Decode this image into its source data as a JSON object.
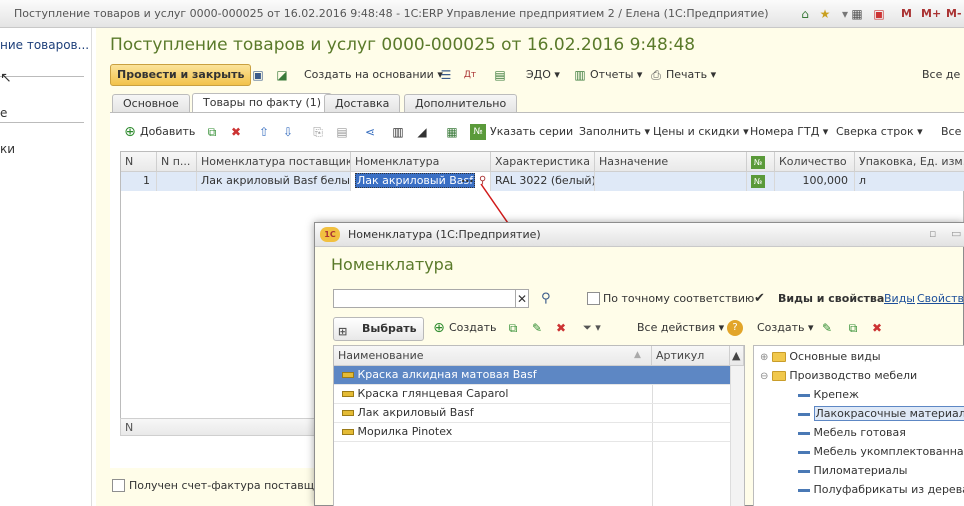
{
  "window": {
    "title": "Поступление товаров и услуг 0000-000025 от 16.02.2016 9:48:48 - 1С:ERP Управление предприятием 2 / Елена  (1С:Предприятие)",
    "m": "M",
    "mplus": "M+",
    "mminus": "M-"
  },
  "left": {
    "item1": "ние товаров...",
    "item2": "е",
    "item3": "ки"
  },
  "form": {
    "title": "Поступление товаров и услуг 0000-000025 от 16.02.2016 9:48:48",
    "post_close": "Провести и закрыть",
    "create_based": "Создать на основании",
    "edo": "ЭДО",
    "reports": "Отчеты",
    "print": "Печать",
    "all_actions": "Все де",
    "tabs": [
      "Основное",
      "Товары по факту (1)",
      "Доставка",
      "Дополнительно"
    ],
    "toolbar": {
      "add": "Добавить",
      "series": "Указать серии",
      "fill": "Заполнить",
      "prices": "Цены и скидки",
      "gtd": "Номера ГТД",
      "check": "Сверка строк",
      "all": "Все"
    },
    "columns": [
      "N",
      "N п...",
      "Номенклатура поставщика",
      "Номенклатура",
      "Характеристика",
      "Назначение",
      "№",
      "Количество",
      "Упаковка, Ед. изм."
    ],
    "row": {
      "n": "1",
      "supplier_item": "Лак акриловый Basf белый",
      "item": "Лак акриловый Basf",
      "dots": "...",
      "characteristic": "RAL 3022 (белый)",
      "quantity": "100,000",
      "unit": "л",
      "icon_label": "№"
    },
    "footer_col": "N",
    "invoice_check": "Получен счет-фактура поставщика N"
  },
  "dialog": {
    "title": "Номенклатура  (1С:Предприятие)",
    "heading": "Номенклатура",
    "exact": "По точному соответствию",
    "kinds": "Виды и свойства",
    "kinds_link": "Виды",
    "props_link": "Свойства",
    "select": "Выбрать",
    "create": "Создать",
    "all_actions": "Все действия",
    "create2": "Создать",
    "col_name": "Наименование",
    "col_article": "Артикул",
    "items": [
      "Краска алкидная матовая Basf",
      "Краска глянцевая Caparol",
      "Лак акриловый Basf",
      "Морилка Pinotex"
    ],
    "tree": [
      "Основные виды",
      "Производство мебели",
      "Крепеж",
      "Лакокрасочные материалы",
      "Мебель готовая",
      "Мебель укомплектованная к",
      "Пиломатериалы",
      "Полуфабрикаты из дерева и"
    ]
  },
  "colors": {
    "accent_title": "#5a7a2a",
    "form_bg": "#fffde9",
    "selection": "#dfe9f7",
    "primary_button": "#f2c24a",
    "arrow": "#d11a1a"
  }
}
